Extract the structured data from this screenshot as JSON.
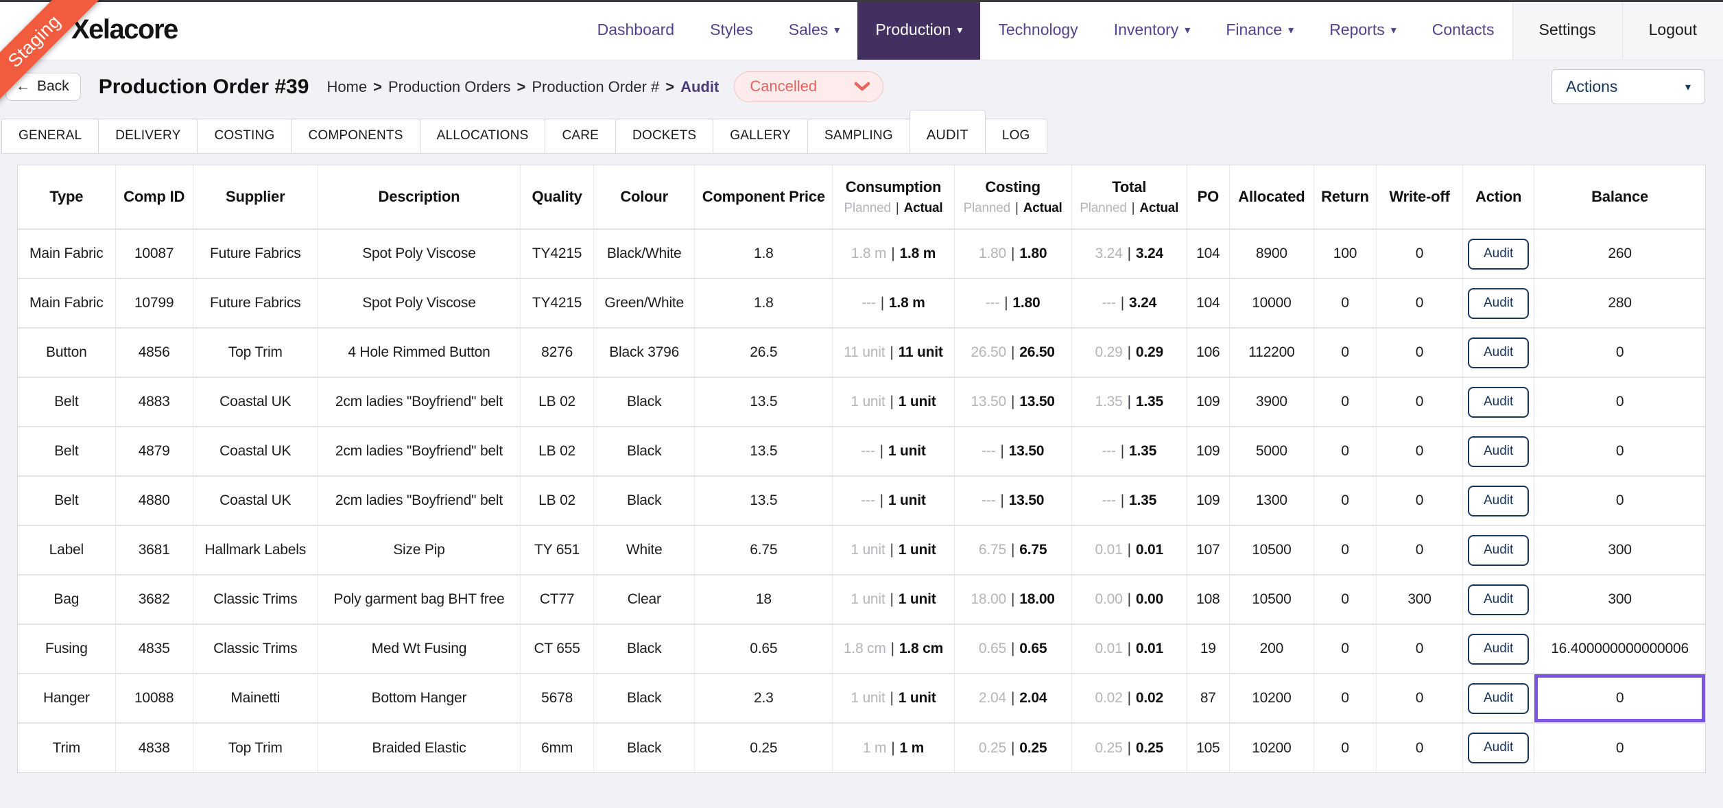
{
  "brand": {
    "logo_text": "Xelacore",
    "staging_label": "Staging"
  },
  "icons": {
    "back_arrow": "←",
    "caret_down": "▾"
  },
  "colors": {
    "nav_link": "#53418c",
    "nav_active_bg": "#443060",
    "ribbon_orange": "#f25c3e",
    "status_cancelled_text": "#e7635e",
    "status_cancelled_bg": "#fdeceb",
    "audit_navy": "#17365d",
    "selected_cell_purple": "#7c54e2"
  },
  "nav": {
    "items": [
      {
        "label": "Dashboard",
        "dropdown": false,
        "active": false
      },
      {
        "label": "Styles",
        "dropdown": false,
        "active": false
      },
      {
        "label": "Sales",
        "dropdown": true,
        "active": false
      },
      {
        "label": "Production",
        "dropdown": true,
        "active": true
      },
      {
        "label": "Technology",
        "dropdown": false,
        "active": false
      },
      {
        "label": "Inventory",
        "dropdown": true,
        "active": false
      },
      {
        "label": "Finance",
        "dropdown": true,
        "active": false
      },
      {
        "label": "Reports",
        "dropdown": true,
        "active": false
      },
      {
        "label": "Contacts",
        "dropdown": false,
        "active": false
      }
    ],
    "settings_label": "Settings",
    "logout_label": "Logout"
  },
  "header": {
    "back_label": "Back",
    "title": "Production Order #39",
    "breadcrumb": [
      "Home",
      "Production Orders",
      "Production Order #",
      "Audit"
    ],
    "breadcrumb_separator": ">",
    "status": "Cancelled",
    "actions_label": "Actions"
  },
  "tabs": [
    "GENERAL",
    "DELIVERY",
    "COSTING",
    "COMPONENTS",
    "ALLOCATIONS",
    "CARE",
    "DOCKETS",
    "GALLERY",
    "SAMPLING",
    "AUDIT",
    "LOG"
  ],
  "active_tab": "AUDIT",
  "table": {
    "planned_label": "Planned",
    "actual_label": "Actual",
    "pipe": "|",
    "audit_button_label": "Audit",
    "columns": [
      {
        "key": "type",
        "label": "Type"
      },
      {
        "key": "comp_id",
        "label": "Comp ID"
      },
      {
        "key": "supplier",
        "label": "Supplier"
      },
      {
        "key": "description",
        "label": "Description"
      },
      {
        "key": "quality",
        "label": "Quality"
      },
      {
        "key": "colour",
        "label": "Colour"
      },
      {
        "key": "component_price",
        "label": "Component Price"
      },
      {
        "key": "consumption",
        "label": "Consumption",
        "split": true
      },
      {
        "key": "costing",
        "label": "Costing",
        "split": true
      },
      {
        "key": "total",
        "label": "Total",
        "split": true
      },
      {
        "key": "po",
        "label": "PO"
      },
      {
        "key": "allocated",
        "label": "Allocated"
      },
      {
        "key": "return",
        "label": "Return"
      },
      {
        "key": "write_off",
        "label": "Write-off"
      },
      {
        "key": "action",
        "label": "Action",
        "action": true
      },
      {
        "key": "balance",
        "label": "Balance",
        "balance": true
      }
    ],
    "rows": [
      {
        "type": "Main Fabric",
        "comp_id": "10087",
        "supplier": "Future Fabrics",
        "description": "Spot Poly Viscose",
        "quality": "TY4215",
        "colour": "Black/White",
        "component_price": "1.8",
        "consumption": {
          "planned": "1.8 m",
          "actual": "1.8 m"
        },
        "costing": {
          "planned": "1.80",
          "actual": "1.80"
        },
        "total": {
          "planned": "3.24",
          "actual": "3.24"
        },
        "po": "104",
        "allocated": "8900",
        "return": "100",
        "write_off": "0",
        "balance": "260",
        "balance_selected": false
      },
      {
        "type": "Main Fabric",
        "comp_id": "10799",
        "supplier": "Future Fabrics",
        "description": "Spot Poly Viscose",
        "quality": "TY4215",
        "colour": "Green/White",
        "component_price": "1.8",
        "consumption": {
          "planned": "---",
          "actual": "1.8 m"
        },
        "costing": {
          "planned": "---",
          "actual": "1.80"
        },
        "total": {
          "planned": "---",
          "actual": "3.24"
        },
        "po": "104",
        "allocated": "10000",
        "return": "0",
        "write_off": "0",
        "balance": "280",
        "balance_selected": false
      },
      {
        "type": "Button",
        "comp_id": "4856",
        "supplier": "Top Trim",
        "description": "4 Hole Rimmed Button",
        "quality": "8276",
        "colour": "Black 3796",
        "component_price": "26.5",
        "consumption": {
          "planned": "11 unit",
          "actual": "11 unit"
        },
        "costing": {
          "planned": "26.50",
          "actual": "26.50"
        },
        "total": {
          "planned": "0.29",
          "actual": "0.29"
        },
        "po": "106",
        "allocated": "112200",
        "return": "0",
        "write_off": "0",
        "balance": "0",
        "balance_selected": false
      },
      {
        "type": "Belt",
        "comp_id": "4883",
        "supplier": "Coastal UK",
        "description": "2cm ladies \"Boyfriend\" belt",
        "quality": "LB 02",
        "colour": "Black",
        "component_price": "13.5",
        "consumption": {
          "planned": "1 unit",
          "actual": "1 unit"
        },
        "costing": {
          "planned": "13.50",
          "actual": "13.50"
        },
        "total": {
          "planned": "1.35",
          "actual": "1.35"
        },
        "po": "109",
        "allocated": "3900",
        "return": "0",
        "write_off": "0",
        "balance": "0",
        "balance_selected": false
      },
      {
        "type": "Belt",
        "comp_id": "4879",
        "supplier": "Coastal UK",
        "description": "2cm ladies \"Boyfriend\" belt",
        "quality": "LB 02",
        "colour": "Black",
        "component_price": "13.5",
        "consumption": {
          "planned": "---",
          "actual": "1 unit"
        },
        "costing": {
          "planned": "---",
          "actual": "13.50"
        },
        "total": {
          "planned": "---",
          "actual": "1.35"
        },
        "po": "109",
        "allocated": "5000",
        "return": "0",
        "write_off": "0",
        "balance": "0",
        "balance_selected": false
      },
      {
        "type": "Belt",
        "comp_id": "4880",
        "supplier": "Coastal UK",
        "description": "2cm ladies \"Boyfriend\" belt",
        "quality": "LB 02",
        "colour": "Black",
        "component_price": "13.5",
        "consumption": {
          "planned": "---",
          "actual": "1 unit"
        },
        "costing": {
          "planned": "---",
          "actual": "13.50"
        },
        "total": {
          "planned": "---",
          "actual": "1.35"
        },
        "po": "109",
        "allocated": "1300",
        "return": "0",
        "write_off": "0",
        "balance": "0",
        "balance_selected": false
      },
      {
        "type": "Label",
        "comp_id": "3681",
        "supplier": "Hallmark Labels",
        "description": "Size Pip",
        "quality": "TY 651",
        "colour": "White",
        "component_price": "6.75",
        "consumption": {
          "planned": "1 unit",
          "actual": "1 unit"
        },
        "costing": {
          "planned": "6.75",
          "actual": "6.75"
        },
        "total": {
          "planned": "0.01",
          "actual": "0.01"
        },
        "po": "107",
        "allocated": "10500",
        "return": "0",
        "write_off": "0",
        "balance": "300",
        "balance_selected": false
      },
      {
        "type": "Bag",
        "comp_id": "3682",
        "supplier": "Classic Trims",
        "description": "Poly garment bag BHT free",
        "quality": "CT77",
        "colour": "Clear",
        "component_price": "18",
        "consumption": {
          "planned": "1 unit",
          "actual": "1 unit"
        },
        "costing": {
          "planned": "18.00",
          "actual": "18.00"
        },
        "total": {
          "planned": "0.00",
          "actual": "0.00"
        },
        "po": "108",
        "allocated": "10500",
        "return": "0",
        "write_off": "300",
        "balance": "300",
        "balance_selected": false
      },
      {
        "type": "Fusing",
        "comp_id": "4835",
        "supplier": "Classic Trims",
        "description": "Med Wt Fusing",
        "quality": "CT 655",
        "colour": "Black",
        "component_price": "0.65",
        "consumption": {
          "planned": "1.8 cm",
          "actual": "1.8 cm"
        },
        "costing": {
          "planned": "0.65",
          "actual": "0.65"
        },
        "total": {
          "planned": "0.01",
          "actual": "0.01"
        },
        "po": "19",
        "allocated": "200",
        "return": "0",
        "write_off": "0",
        "balance": "16.400000000000006",
        "balance_selected": false
      },
      {
        "type": "Hanger",
        "comp_id": "10088",
        "supplier": "Mainetti",
        "description": "Bottom Hanger",
        "quality": "5678",
        "colour": "Black",
        "component_price": "2.3",
        "consumption": {
          "planned": "1 unit",
          "actual": "1 unit"
        },
        "costing": {
          "planned": "2.04",
          "actual": "2.04"
        },
        "total": {
          "planned": "0.02",
          "actual": "0.02"
        },
        "po": "87",
        "allocated": "10200",
        "return": "0",
        "write_off": "0",
        "balance": "0",
        "balance_selected": true
      },
      {
        "type": "Trim",
        "comp_id": "4838",
        "supplier": "Top Trim",
        "description": "Braided Elastic",
        "quality": "6mm",
        "colour": "Black",
        "component_price": "0.25",
        "consumption": {
          "planned": "1 m",
          "actual": "1 m"
        },
        "costing": {
          "planned": "0.25",
          "actual": "0.25"
        },
        "total": {
          "planned": "0.25",
          "actual": "0.25"
        },
        "po": "105",
        "allocated": "10200",
        "return": "0",
        "write_off": "0",
        "balance": "0",
        "balance_selected": false
      }
    ]
  }
}
